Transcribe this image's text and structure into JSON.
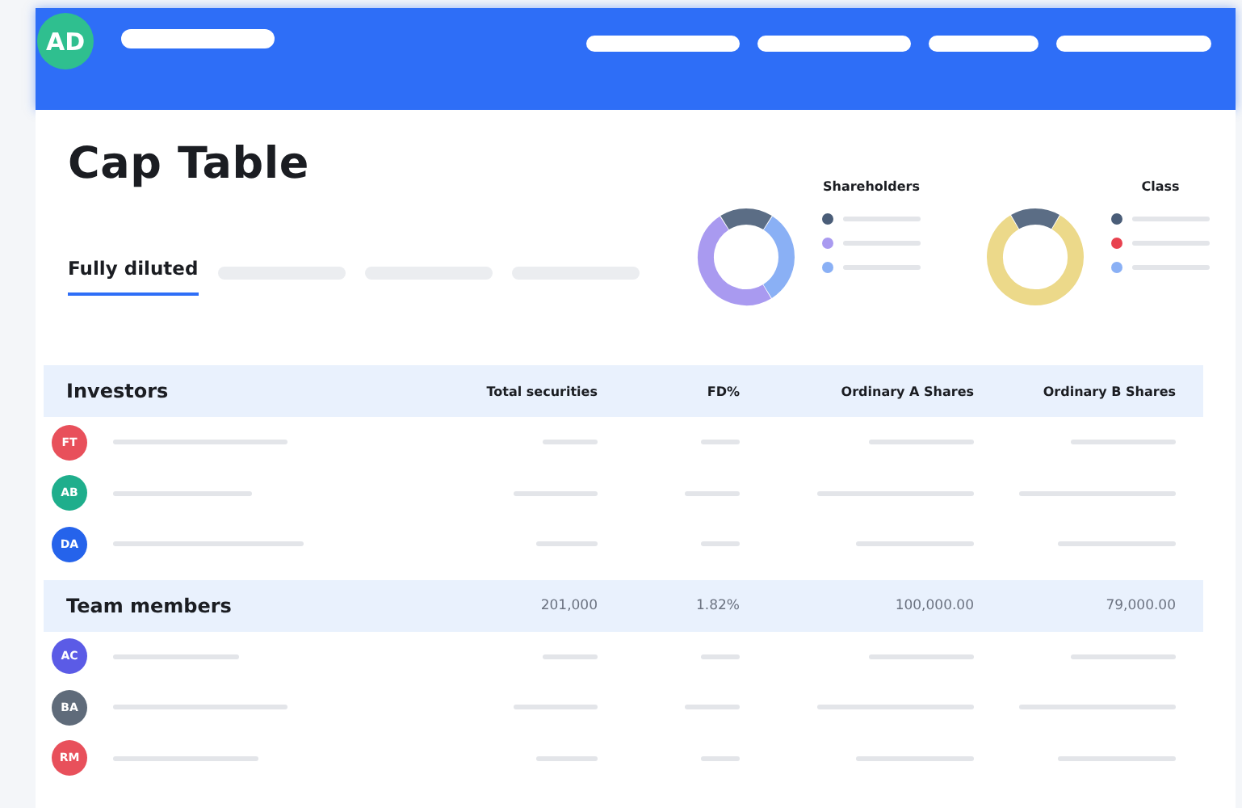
{
  "header": {
    "avatar": "AD"
  },
  "title": "Cap Table",
  "tabs": [
    {
      "label": "Fully diluted",
      "selected": true
    }
  ],
  "charts": [
    {
      "title": "Shareholders",
      "legend": [
        {
          "color": "#4a5d78"
        },
        {
          "color": "#a99af0"
        },
        {
          "color": "#8ab0f5"
        }
      ]
    },
    {
      "title": "Class",
      "legend": [
        {
          "color": "#4a5d78"
        },
        {
          "color": "#e8424f"
        },
        {
          "color": "#8ab0f5"
        }
      ]
    }
  ],
  "sections": [
    {
      "name": "Investors",
      "cells": [
        "Total securities",
        "FD%",
        "Ordinary A Shares",
        "Ordinary B Shares"
      ],
      "kind": "heading",
      "rows": [
        {
          "initials": "FT",
          "color": "#e8505b"
        },
        {
          "initials": "AB",
          "color": "#1fae8c"
        },
        {
          "initials": "DA",
          "color": "#2563eb"
        }
      ]
    },
    {
      "name": "Team members",
      "cells": [
        "201,000",
        "1.82%",
        "100,000.00",
        "79,000.00"
      ],
      "kind": "totals",
      "rows": [
        {
          "initials": "AC",
          "color": "#5b5be6"
        },
        {
          "initials": "BA",
          "color": "#5f6b7a"
        },
        {
          "initials": "RM",
          "color": "#e8505b"
        }
      ]
    }
  ]
}
